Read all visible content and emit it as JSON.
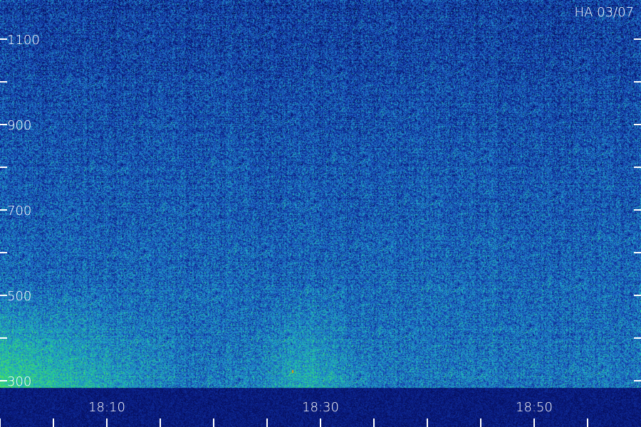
{
  "chart_data": {
    "type": "heatmap",
    "title": "",
    "annotation": "HA 03/07",
    "xlabel": "",
    "ylabel": "",
    "x_tick_labels": [
      "18:10",
      "18:30",
      "18:50"
    ],
    "y_tick_labels": [
      "1100",
      "900",
      "700",
      "500",
      "300"
    ],
    "y_values": [
      1100,
      900,
      700,
      500,
      300
    ],
    "x_values": [
      "18:10",
      "18:30",
      "18:50"
    ],
    "colormap": [
      "#000033",
      "#0b1f8a",
      "#1f5fc4",
      "#1fa7c8",
      "#27d08a",
      "#5fe84a"
    ],
    "colors": {
      "background": "#000033",
      "text": "#ffffff",
      "ticks": "#ffffff"
    },
    "grid": false
  }
}
